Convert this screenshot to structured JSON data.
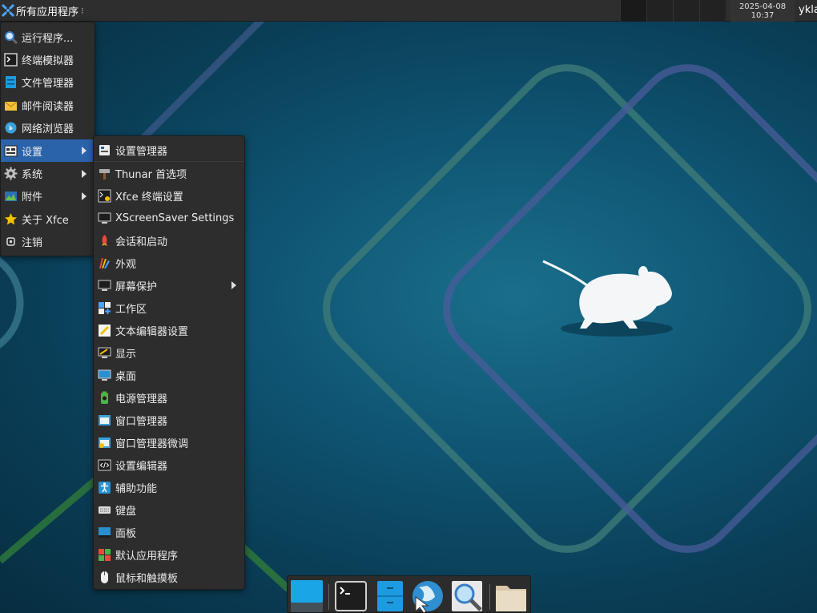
{
  "top_panel": {
    "apps_label": "所有应用程序",
    "clock_date": "2025-04-08",
    "clock_time": "10:37",
    "user": "ykla"
  },
  "main_menu": [
    {
      "label": "运行程序...",
      "icon": "search-icon"
    },
    {
      "label": "终端模拟器",
      "icon": "terminal-icon"
    },
    {
      "label": "文件管理器",
      "icon": "file-manager-icon"
    },
    {
      "label": "邮件阅读器",
      "icon": "mail-icon"
    },
    {
      "label": "网络浏览器",
      "icon": "globe-icon"
    },
    {
      "label": "设置",
      "icon": "settings-icon",
      "submenu": true,
      "active": true
    },
    {
      "label": "系统",
      "icon": "gear-icon",
      "submenu": true
    },
    {
      "label": "附件",
      "icon": "accessories-icon",
      "submenu": true
    },
    {
      "label": "关于 Xfce",
      "icon": "star-icon"
    },
    {
      "label": "注销",
      "icon": "logout-icon"
    }
  ],
  "settings_menu": [
    {
      "label": "设置管理器",
      "icon": "settings-manager-icon"
    },
    {
      "label": "Thunar 首选项",
      "icon": "hammer-icon"
    },
    {
      "label": "Xfce 终端设置",
      "icon": "terminal-settings-icon"
    },
    {
      "label": "XScreenSaver Settings",
      "icon": "screensaver-icon"
    },
    {
      "label": "会话和启动",
      "icon": "rocket-icon"
    },
    {
      "label": "外观",
      "icon": "appearance-icon"
    },
    {
      "label": "屏幕保护",
      "icon": "screensaver-icon",
      "submenu": true
    },
    {
      "label": "工作区",
      "icon": "workspace-icon"
    },
    {
      "label": "文本编辑器设置",
      "icon": "text-editor-icon"
    },
    {
      "label": "显示",
      "icon": "display-icon"
    },
    {
      "label": "桌面",
      "icon": "desktop-icon"
    },
    {
      "label": "电源管理器",
      "icon": "battery-icon"
    },
    {
      "label": "窗口管理器",
      "icon": "window-manager-icon"
    },
    {
      "label": "窗口管理器微调",
      "icon": "window-tweaks-icon"
    },
    {
      "label": "设置编辑器",
      "icon": "code-icon"
    },
    {
      "label": "辅助功能",
      "icon": "accessibility-icon"
    },
    {
      "label": "键盘",
      "icon": "keyboard-icon"
    },
    {
      "label": "面板",
      "icon": "panel-icon"
    },
    {
      "label": "默认应用程序",
      "icon": "default-apps-icon"
    },
    {
      "label": "鼠标和触摸板",
      "icon": "mouse-icon"
    }
  ],
  "dock": [
    {
      "icon": "show-desktop-icon"
    },
    {
      "icon": "terminal-icon"
    },
    {
      "icon": "file-manager-icon"
    },
    {
      "icon": "web-browser-icon"
    },
    {
      "icon": "app-finder-icon"
    },
    {
      "icon": "folder-icon"
    }
  ],
  "colors": {
    "menu_bg": "#2d2d2d",
    "highlight": "#2a63aa",
    "panel_bg": "#2e2e2e",
    "wallpaper": "#0f5573"
  }
}
